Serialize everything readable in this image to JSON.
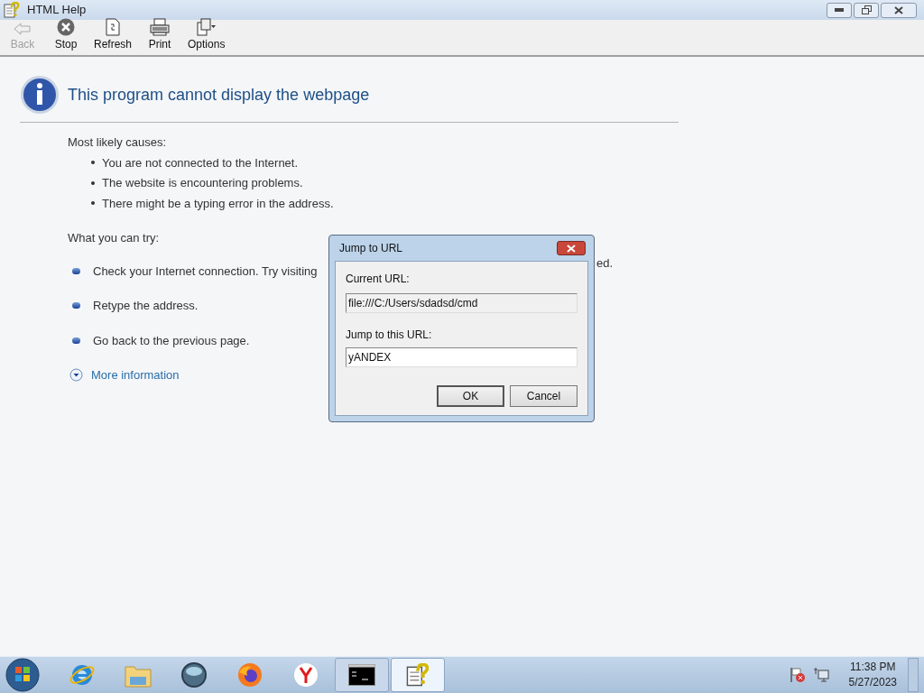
{
  "window": {
    "title": "HTML Help"
  },
  "toolbar": [
    {
      "kind": "back",
      "label": "Back",
      "disabled": true
    },
    {
      "kind": "stop",
      "label": "Stop",
      "disabled": false
    },
    {
      "kind": "refresh",
      "label": "Refresh",
      "disabled": false
    },
    {
      "kind": "print",
      "label": "Print",
      "disabled": false
    },
    {
      "kind": "options",
      "label": "Options",
      "disabled": false
    }
  ],
  "page": {
    "heading": "This program cannot display the webpage",
    "causes_title": "Most likely causes:",
    "causes": [
      "You are not connected to the Internet.",
      "The website is encountering problems.",
      "There might be a typing error in the address."
    ],
    "try_title": "What you can try:",
    "tries": [
      {
        "text": "Check your Internet connection. Try visiting",
        "tail": "ed."
      },
      {
        "text": "Retype the address."
      },
      {
        "text": "Go back to the previous page."
      }
    ],
    "more": {
      "label": "More information",
      "expanded": false
    }
  },
  "dialog": {
    "title": "Jump to URL",
    "current_label": "Current URL:",
    "current_value": "file:///C:/Users/sdadsd/cmd",
    "jump_label": "Jump to this URL:",
    "jump_value": "yANDEX",
    "buttons": [
      {
        "label": "OK",
        "default": true
      },
      {
        "label": "Cancel",
        "default": false
      }
    ]
  },
  "taskbar": {
    "items": [
      {
        "kind": "ie",
        "running": false,
        "selected": false
      },
      {
        "kind": "explorer",
        "running": false,
        "selected": false
      },
      {
        "kind": "globe",
        "running": false,
        "selected": false
      },
      {
        "kind": "firefox",
        "running": false,
        "selected": false
      },
      {
        "kind": "yandex",
        "running": false,
        "selected": false
      },
      {
        "kind": "cmd",
        "running": true,
        "selected": false
      },
      {
        "kind": "help",
        "running": true,
        "selected": true
      }
    ],
    "time": "11:38 PM",
    "date": "5/27/2023"
  }
}
